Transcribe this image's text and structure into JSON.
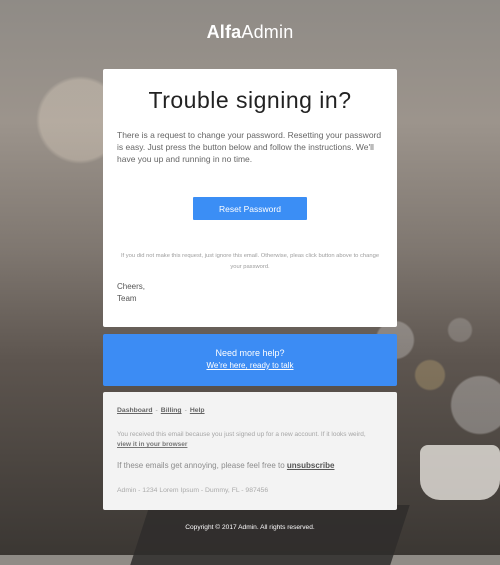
{
  "brand": {
    "logo_bold": "Alfa",
    "logo_regular": "Admin"
  },
  "main_card": {
    "title": "Trouble signing in?",
    "body": "There is a request to change your password. Resetting your password is easy. Just press the button below and follow the instructions. We'll have you up and running in no time.",
    "button_label": "Reset Password",
    "note": "If you did not make this request, just ignore this email. Otherwise, pleas click button above to change your password.",
    "signoff_line1": "Cheers,",
    "signoff_line2": "Team"
  },
  "help_box": {
    "title": "Need more help?",
    "link_text": "We’re here, ready to talk"
  },
  "footer": {
    "links": [
      "Dashboard",
      "Billing",
      "Help"
    ],
    "separator": "-",
    "received_text": "You received this email because you just signed up for a new account. If it looks weird,",
    "view_in_browser": "view it in your browser",
    "annoying_text": "If these emails get annoying, please feel free to",
    "unsubscribe": "unsubscribe",
    "address": "Admin - 1234 Lorem Ipsum - Dummy, FL - 987456"
  },
  "copyright": "Copyright © 2017 Admin. All rights reserved."
}
